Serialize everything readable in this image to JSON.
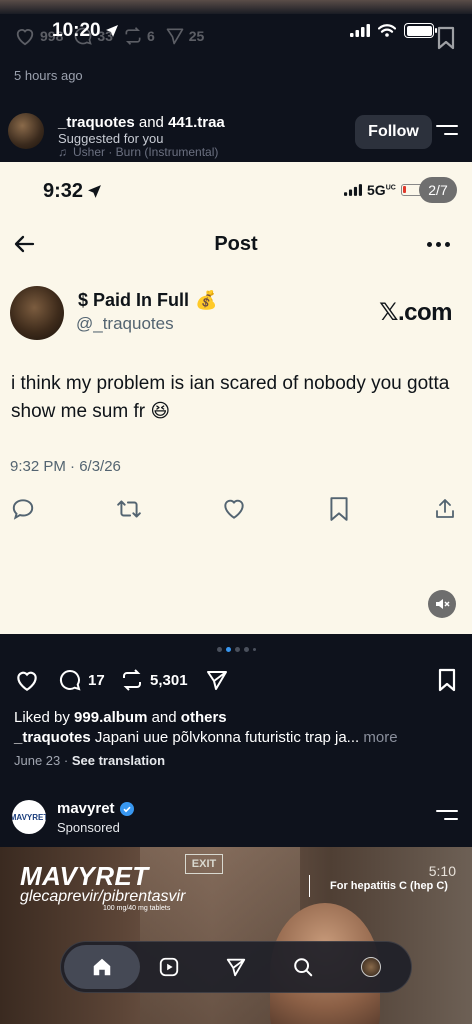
{
  "status_bar": {
    "time": "10:20"
  },
  "top_ghost": {
    "likes": "998",
    "comments": "33",
    "reposts": "6",
    "shares": "25"
  },
  "previous_post": {
    "time_ago": "5 hours ago"
  },
  "suggested": {
    "name1": "_traquotes",
    "and": "and",
    "name2": "441.traa",
    "subtitle": "Suggested for you",
    "music": "Usher · Burn (Instrumental)",
    "follow_label": "Follow"
  },
  "embedded": {
    "time": "9:32",
    "network": "5G",
    "network_sup": "UC",
    "page_indicator": "2/7",
    "header_title": "Post",
    "display_name": "$ Paid In Full",
    "name_emoji": "💰",
    "handle": "@_traquotes",
    "source": "𝕏.com",
    "text": "i think my problem is ian scared of nobody you gotta show me sum fr 😆",
    "timestamp": "9:32 PM · 6/3/26"
  },
  "post": {
    "comments": "17",
    "reposts": "5,301",
    "liked_prefix": "Liked by",
    "liked_user": "999.album",
    "liked_mid": "and",
    "liked_others": "others",
    "caption_user": "_traquotes",
    "caption_text": "Japani uue põlvkonna futuristic trap ja...",
    "caption_more": "more",
    "date": "June 23",
    "see_translation": "See translation"
  },
  "sponsored": {
    "account": "mavyret",
    "label": "Sponsored",
    "avatar_text": "MAVYRET"
  },
  "ad": {
    "brand": "MAVYRET",
    "generic": "glecaprevir/pibrentasvir",
    "dose": "100 mg/40 mg tablets",
    "indication": "For hepatitis C (hep C)",
    "duration": "5:10",
    "exit_sign": "EXIT"
  },
  "colors": {
    "accent": "#3897f0",
    "background": "#0e121c",
    "card": "#fbf7ea",
    "verified": "#3897f0"
  }
}
